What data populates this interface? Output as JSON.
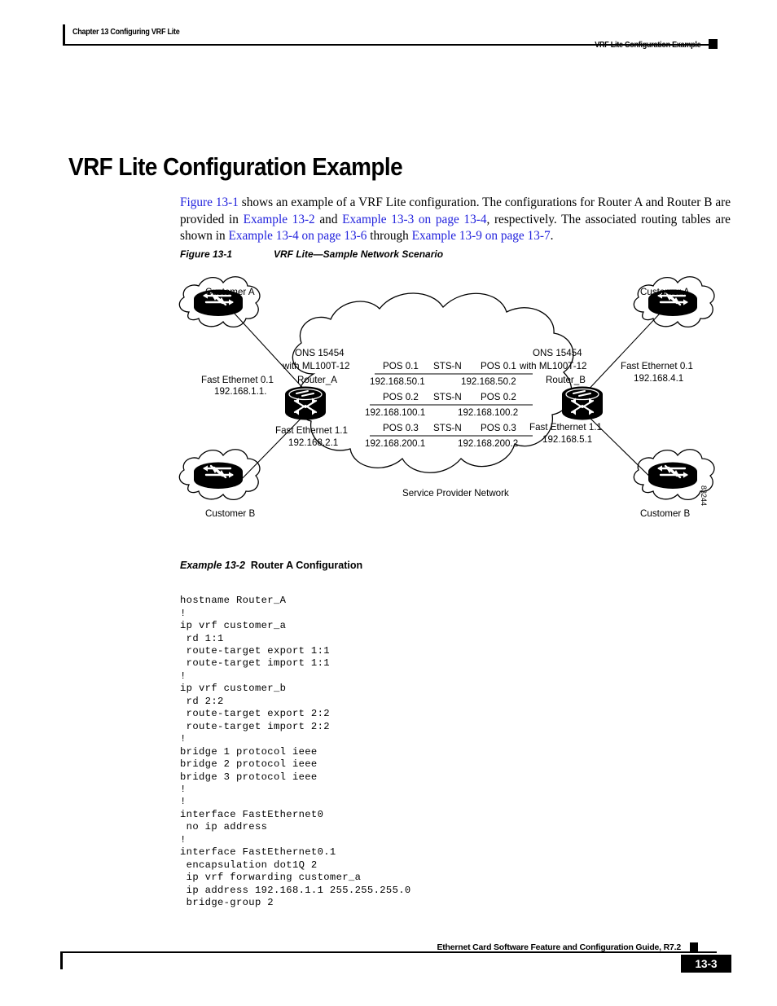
{
  "header": {
    "chapter": "Chapter 13 Configuring VRF Lite",
    "section": "VRF Lite Configuration Example"
  },
  "title": "VRF Lite Configuration Example",
  "intro": {
    "link_figure": "Figure 13-1",
    "text_1": " shows an example of a VRF Lite configuration. The configurations for Router A and Router B are provided in ",
    "link_ex2": "Example 13-2",
    "text_2": " and ",
    "link_ex3": "Example 13-3 on page 13-4",
    "text_3": ", respectively. The associated routing tables are shown in ",
    "link_ex4": "Example 13-4 on page 13-6",
    "text_4": " through ",
    "link_ex9": "Example 13-9 on page 13-7",
    "text_5": "."
  },
  "figure": {
    "caption_number": "Figure 13-1",
    "caption_title": "VRF Lite—Sample Network Scenario",
    "figure_id": "83244",
    "cloud_label": "Service Provider Network",
    "left": {
      "customer_a": "Customer A",
      "customer_b": "Customer B",
      "ons_line1": "ONS 15454",
      "ons_line2": "with ML100T-12",
      "router_name": "Router_A",
      "fe0_line1": "Fast Ethernet 0.1",
      "fe0_line2": "192.168.1.1.",
      "fe1_line1": "Fast Ethernet 1.1",
      "fe1_line2": "192.168.2.1"
    },
    "right": {
      "customer_a": "Customer A",
      "customer_b": "Customer B",
      "ons_line1": "ONS 15454",
      "ons_line2": "with ML100T-12",
      "router_name": "Router_B",
      "fe0_line1": "Fast Ethernet 0.1",
      "fe0_line2": "192.168.4.1",
      "fe1_line1": "Fast Ethernet 1.1",
      "fe1_line2": "192.168.5.1"
    },
    "links": [
      {
        "left_port": "POS 0.1",
        "sts": "STS-N",
        "right_port": "POS 0.1",
        "left_ip": "192.168.50.1",
        "right_ip": "192.168.50.2"
      },
      {
        "left_port": "POS 0.2",
        "sts": "STS-N",
        "right_port": "POS 0.2",
        "left_ip": "192.168.100.1",
        "right_ip": "192.168.100.2"
      },
      {
        "left_port": "POS 0.3",
        "sts": "STS-N",
        "right_port": "POS 0.3",
        "left_ip": "192.168.200.1",
        "right_ip": "192.168.200.2"
      }
    ]
  },
  "example": {
    "caption_number": "Example 13-2",
    "caption_title": "Router A Configuration",
    "code": "hostname Router_A\n!\nip vrf customer_a\n rd 1:1\n route-target export 1:1\n route-target import 1:1\n!\nip vrf customer_b\n rd 2:2\n route-target export 2:2\n route-target import 2:2\n!\nbridge 1 protocol ieee\nbridge 2 protocol ieee\nbridge 3 protocol ieee\n!\n!\ninterface FastEthernet0\n no ip address\n!\ninterface FastEthernet0.1\n encapsulation dot1Q 2\n ip vrf forwarding customer_a\n ip address 192.168.1.1 255.255.255.0\n bridge-group 2"
  },
  "footer": {
    "guide_title": "Ethernet Card Software Feature and Configuration Guide, R7.2",
    "page_number": "13-3"
  }
}
